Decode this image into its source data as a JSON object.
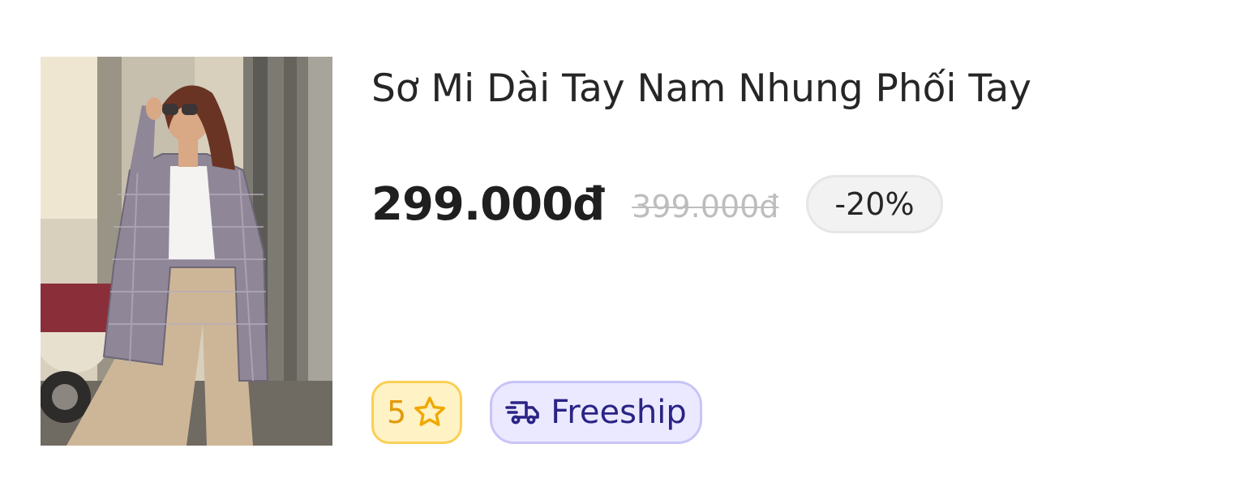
{
  "product": {
    "image_alt": "product-photo",
    "title": "Sơ Mi Dài Tay Nam Nhung Phối Tay",
    "price": "299.000đ",
    "old_price": "399.000đ",
    "discount": "-20%",
    "rating": "5",
    "shipping_label": "Freeship"
  },
  "icons": {
    "rating": "star-icon",
    "shipping": "truck-icon"
  },
  "colors": {
    "title_text": "#262626",
    "old_price": "#bdbdbd",
    "discount_bg": "#f2f2f2",
    "rating_bg": "#fff2c4",
    "rating_border": "#f9cf55",
    "rating_text": "#e39a0a",
    "ship_bg": "#ebe9ff",
    "ship_border": "#c9c4f7",
    "ship_text": "#2a2486"
  }
}
